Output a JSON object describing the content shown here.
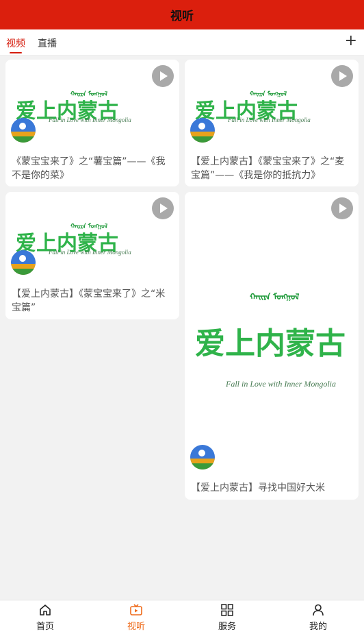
{
  "header": {
    "title": "视听"
  },
  "tabs": [
    {
      "label": "视频",
      "active": true
    },
    {
      "label": "直播",
      "active": false
    }
  ],
  "add_icon": "plus-icon",
  "logo": {
    "mongolian": "ᠬᠠᠢᠷᠠ ᠮᠣᠩᠭᠣᠯ",
    "chinese": "爱上内蒙古",
    "english": "Fall in Love with Inner Mongolia"
  },
  "videos": [
    {
      "title": "《蒙宝宝来了》之“薯宝篇”——《我不是你的菜》"
    },
    {
      "title": "【爱上内蒙古】《蒙宝宝来了》之“麦宝篇”——《我是你的抵抗力》"
    },
    {
      "title": "【爱上内蒙古】《蒙宝宝来了》之“米宝篇”"
    },
    {
      "title": "【爱上内蒙古】寻找中国好大米"
    }
  ],
  "bottom_nav": [
    {
      "label": "首页",
      "icon": "home-icon",
      "active": false
    },
    {
      "label": "视听",
      "icon": "tv-icon",
      "active": true
    },
    {
      "label": "服务",
      "icon": "grid-icon",
      "active": false
    },
    {
      "label": "我的",
      "icon": "user-icon",
      "active": false
    }
  ],
  "colors": {
    "brand": "#db1f0d",
    "active_tab": "#d51d0e",
    "active_nav": "#ee6a1a",
    "logo_green": "#2fb34a"
  }
}
